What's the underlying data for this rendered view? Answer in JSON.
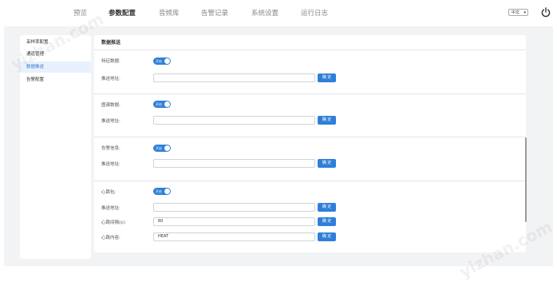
{
  "nav": {
    "items": [
      "预览",
      "参数配置",
      "音频库",
      "告警记录",
      "系统设置",
      "运行日志"
    ],
    "active": "参数配置"
  },
  "language": {
    "selected": "中文"
  },
  "sidebar": {
    "items": [
      {
        "label": "采样率配置"
      },
      {
        "label": "通道管理"
      },
      {
        "label": "数据推送",
        "active": true
      },
      {
        "label": "告警配置"
      }
    ]
  },
  "panel": {
    "title": "数据推送",
    "sections": [
      {
        "name": "特征数据:",
        "toggle": "开启",
        "fields": [
          {
            "label": "推送地址:",
            "value": "",
            "button": "确 定"
          }
        ]
      },
      {
        "name": "图谱数据:",
        "toggle": "开启",
        "fields": [
          {
            "label": "推送地址:",
            "value": "",
            "button": "确 定"
          }
        ]
      },
      {
        "name": "告警信息:",
        "toggle": "开启",
        "fields": [
          {
            "label": "推送地址:",
            "value": "",
            "button": "确 定"
          }
        ]
      },
      {
        "name": "心跳包:",
        "toggle": "开启",
        "fields": [
          {
            "label": "推送地址:",
            "value": "",
            "button": "确 定"
          },
          {
            "label": "心跳间隔(s):",
            "value": "60",
            "button": "确 定"
          },
          {
            "label": "心跳内容:",
            "value": "HEAT",
            "button": "确 定"
          }
        ]
      }
    ]
  },
  "colors": {
    "accent": "#2f7fd8",
    "background": "#f2f3f5"
  },
  "watermark": "yizhan.com"
}
